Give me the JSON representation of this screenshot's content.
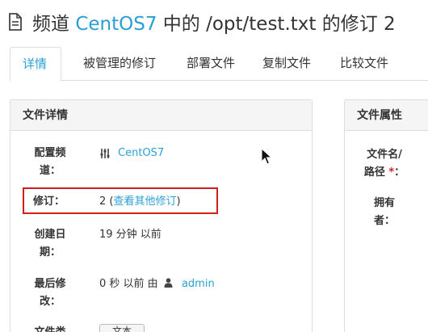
{
  "header": {
    "title_prefix": "频道",
    "channel_link": "CentOS7",
    "title_suffix": "中的 /opt/test.txt 的修订 2"
  },
  "tabs": [
    {
      "label": "详情",
      "active": true
    },
    {
      "label": "被管理的修订",
      "active": false
    },
    {
      "label": "部署文件",
      "active": false
    },
    {
      "label": "复制文件",
      "active": false
    },
    {
      "label": "比较文件",
      "active": false
    }
  ],
  "details_panel": {
    "heading": "文件详情",
    "config_channel": {
      "label_line1": "配置频",
      "label_line2": "道：",
      "value": "CentOS7",
      "icon": "channel-icon"
    },
    "revision": {
      "label": "修订：",
      "value_prefix": "2 (",
      "link": "查看其他修订",
      "value_suffix": ")"
    },
    "created": {
      "label_line1": "创建日",
      "label_line2": "期：",
      "value": "19 分钟 以前"
    },
    "modified": {
      "label_line1": "最后修",
      "label_line2": "改：",
      "value_prefix": "0 秒 以前 由",
      "user": "admin",
      "icon": "user-icon"
    },
    "file_type": {
      "label": "文件类",
      "button": "文本"
    }
  },
  "properties_panel": {
    "heading": "文件属性",
    "filename": {
      "label_line1": "文件名/",
      "label_line2": "路径",
      "required": "*",
      "colon": "："
    },
    "owner": {
      "label_line1": "拥有",
      "label_line2": "者："
    }
  },
  "colors": {
    "accent": "#2a9fd6",
    "highlight": "#d0201e"
  }
}
